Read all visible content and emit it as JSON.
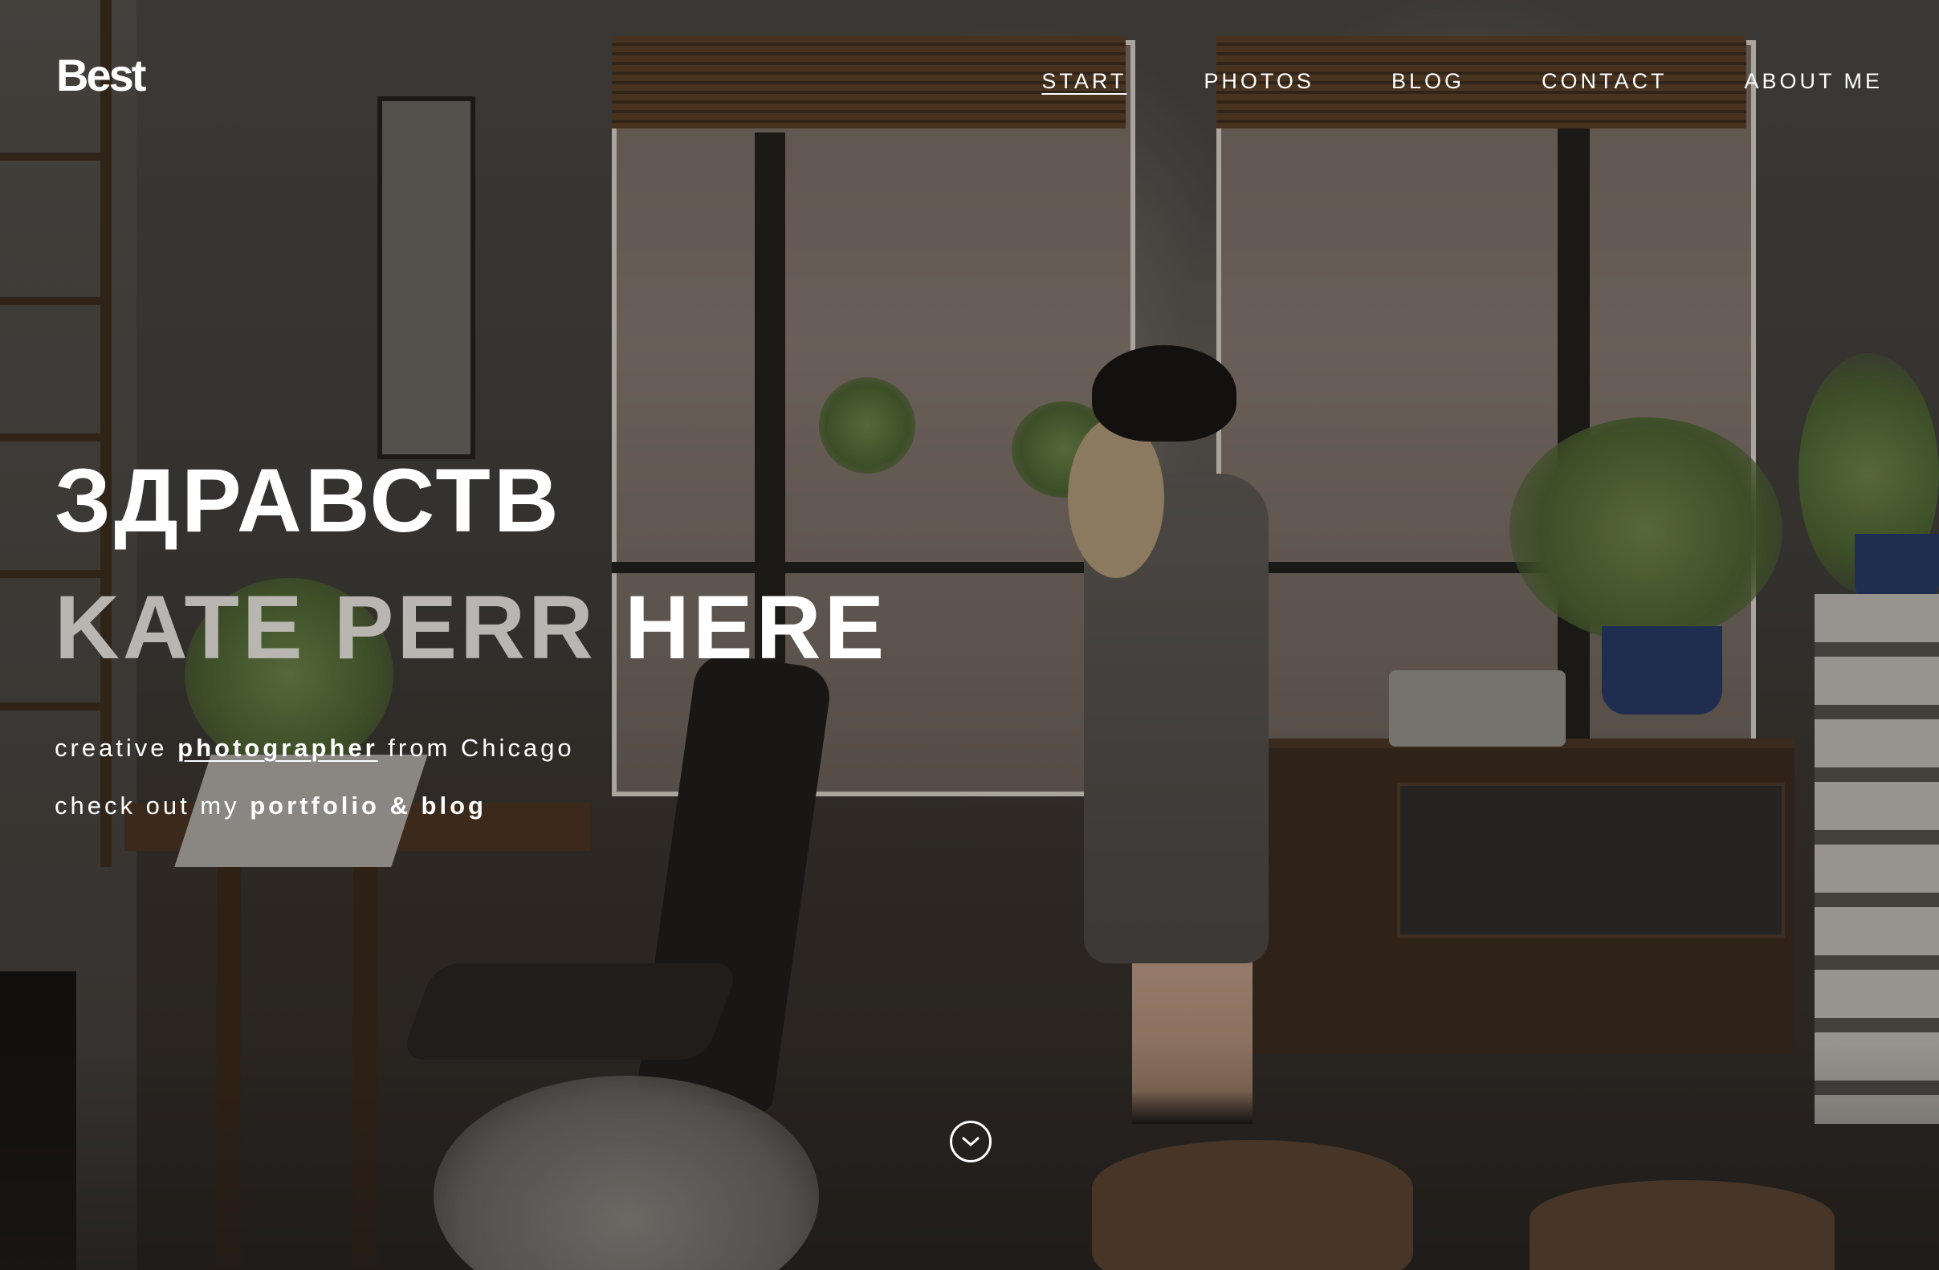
{
  "header": {
    "logo": "Best",
    "nav": [
      {
        "label": "START",
        "active": true
      },
      {
        "label": "PHOTOS",
        "active": false
      },
      {
        "label": "BLOG",
        "active": false
      },
      {
        "label": "CONTACT",
        "active": false
      },
      {
        "label": "ABOUT ME",
        "active": false
      }
    ]
  },
  "hero": {
    "line1": "ЗДРАВСТВ",
    "line2_muted": "KATE PERR",
    "line2_bright": "HERE",
    "tagline": {
      "pre": "creative ",
      "link": "photographer",
      "post": " from Chicago"
    },
    "cta": {
      "pre": "check out my ",
      "link": "portfolio & blog"
    },
    "scroll_icon": "chevron-down-circle-icon"
  },
  "colors": {
    "text": "#ffffff",
    "muted_text": "#b9b6b2"
  }
}
